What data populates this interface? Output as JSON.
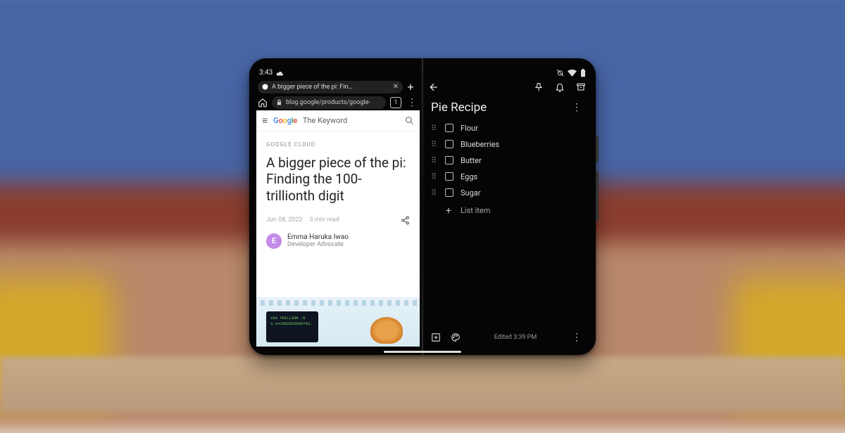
{
  "status": {
    "time": "3:43"
  },
  "browser": {
    "tab_title": "A bigger piece of the pi: Fin…",
    "url": "blog.google/products/google-",
    "tab_count": "1"
  },
  "blog": {
    "site": "The Keyword",
    "category": "GOOGLE CLOUD",
    "headline": "A bigger piece of the pi: Finding the 100-trillionth digit",
    "date": "Jun 08, 2022",
    "readtime": "3 min read",
    "author_initial": "E",
    "author_name": "Emma Haruka Iwao",
    "author_role": "Developer Advocate",
    "term_line1": "100 TRILLION :D",
    "term_line2": "3.141592653589793…"
  },
  "notes": {
    "title": "Pie Recipe",
    "items": [
      "Flour",
      "Blueberries",
      "Butter",
      "Eggs",
      "Sugar"
    ],
    "add_label": "List item",
    "edited": "Edited 3:39 PM"
  }
}
